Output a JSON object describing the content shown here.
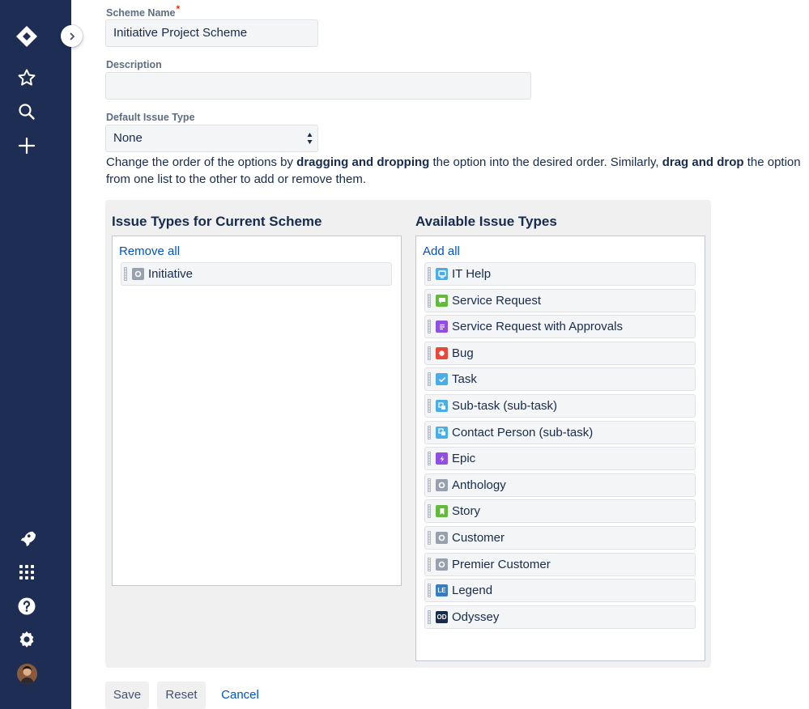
{
  "sidebar": {
    "icons": [
      "jira-logo-icon",
      "star-icon",
      "search-icon",
      "plus-icon",
      "rocket-icon",
      "apps-grid-icon",
      "help-icon",
      "gear-icon"
    ],
    "brand_color": "#1d2d54"
  },
  "form": {
    "scheme_name_label": "Scheme Name",
    "required_mark": "*",
    "scheme_name_value": "Initiative Project Scheme",
    "description_label": "Description",
    "description_value": "",
    "default_type_label": "Default Issue Type",
    "default_type_value": "None",
    "instr_1": "Change the order of the options by ",
    "instr_2": "dragging and dropping",
    "instr_3": " the option into the desired order. Similarly, ",
    "instr_4": "drag and drop",
    "instr_5": " the option from one list to the other to add or remove them."
  },
  "current": {
    "title": "Issue Types for Current Scheme",
    "remove_all": "Remove all",
    "items": [
      {
        "label": "Initiative",
        "icon": "initiative-icon",
        "color": "#97a0af"
      }
    ]
  },
  "available": {
    "title": "Available Issue Types",
    "add_all": "Add all",
    "items": [
      {
        "label": "IT Help",
        "icon": "it-help-icon",
        "color": "#4bade8"
      },
      {
        "label": "Service Request",
        "icon": "service-request-icon",
        "color": "#63ba3c"
      },
      {
        "label": "Service Request with Approvals",
        "icon": "approvals-icon",
        "color": "#904ee2"
      },
      {
        "label": "Bug",
        "icon": "bug-icon",
        "color": "#e5493a"
      },
      {
        "label": "Task",
        "icon": "task-icon",
        "color": "#4bade8"
      },
      {
        "label": "Sub-task (sub-task)",
        "icon": "subtask-icon",
        "color": "#4bade8"
      },
      {
        "label": "Contact Person (sub-task)",
        "icon": "subtask-icon",
        "color": "#4bade8"
      },
      {
        "label": "Epic",
        "icon": "epic-icon",
        "color": "#904ee2"
      },
      {
        "label": "Anthology",
        "icon": "generic-type-icon",
        "color": "#97a0af"
      },
      {
        "label": "Story",
        "icon": "story-icon",
        "color": "#63ba3c"
      },
      {
        "label": "Customer",
        "icon": "generic-type-icon",
        "color": "#97a0af"
      },
      {
        "label": "Premier Customer",
        "icon": "generic-type-icon",
        "color": "#97a0af"
      },
      {
        "label": "Legend",
        "icon": "legend-icon",
        "color": "#3a7bbf",
        "badge": "LE"
      },
      {
        "label": "Odyssey",
        "icon": "odyssey-icon",
        "color": "#172b4d",
        "badge": "OD"
      }
    ]
  },
  "actions": {
    "save": "Save",
    "reset": "Reset",
    "cancel": "Cancel"
  }
}
